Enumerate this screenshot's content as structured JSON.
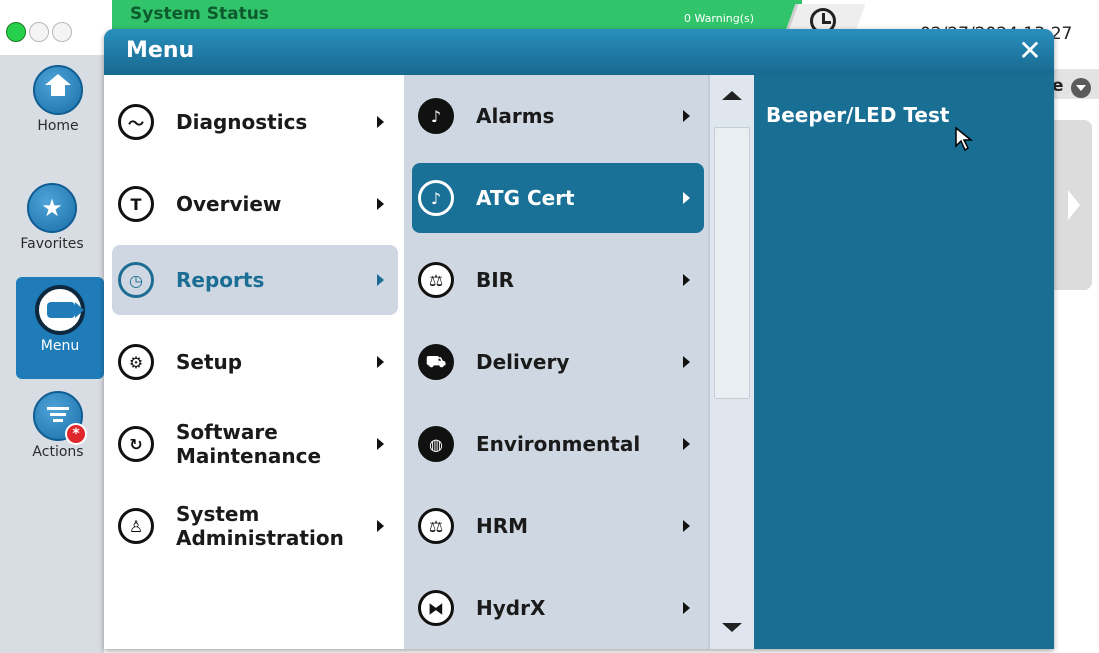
{
  "status_bar": {
    "title": "System Status",
    "warnings": "0 Warning(s)",
    "datetime": "02/27/2024 13:27",
    "right_fragment": "e"
  },
  "left_nav": {
    "items": [
      {
        "label": "Home",
        "icon": "home-icon"
      },
      {
        "label": "Favorites",
        "icon": "star-icon"
      },
      {
        "label": "Menu",
        "icon": "menu-icon"
      },
      {
        "label": "Actions",
        "icon": "actions-icon"
      }
    ],
    "actions_badge": "*"
  },
  "menu": {
    "title": "Menu",
    "close_label": "✕",
    "column1": [
      {
        "label": "Diagnostics",
        "icon": "diagnostics-icon"
      },
      {
        "label": "Overview",
        "icon": "overview-icon"
      },
      {
        "label": "Reports",
        "icon": "reports-clock-icon",
        "selected": true
      },
      {
        "label": "Setup",
        "icon": "setup-gear-icon"
      },
      {
        "label": "Software Maintenance",
        "icon": "software-maintenance-icon"
      },
      {
        "label": "System Administration",
        "icon": "system-administration-icon"
      }
    ],
    "column2": [
      {
        "label": "Alarms",
        "icon": "alarm-bell-icon"
      },
      {
        "label": "ATG Cert",
        "icon": "atg-cert-bell-icon",
        "selected": true
      },
      {
        "label": "BIR",
        "icon": "scale-icon"
      },
      {
        "label": "Delivery",
        "icon": "delivery-truck-icon"
      },
      {
        "label": "Environmental",
        "icon": "globe-icon"
      },
      {
        "label": "HRM",
        "icon": "scale-icon"
      },
      {
        "label": "HydrX",
        "icon": "hydrx-icon"
      }
    ],
    "column3": [
      {
        "label": "Beeper/LED Test"
      }
    ]
  },
  "colors": {
    "menu_blue": "#1a6d91",
    "highlight_blue": "#1a7197",
    "status_green": "#32c46a",
    "nav_blue": "#1f7cb8"
  }
}
